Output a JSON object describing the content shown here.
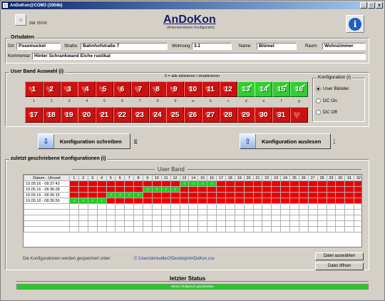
{
  "window": {
    "title": "AnDoKon@COM3 (1004b)",
    "buttons": [
      "_",
      "□",
      "x"
    ]
  },
  "header": {
    "sw_version": "SW: 25703",
    "title": "AnDoKon",
    "subtitle": "(Antennendosen Konfigurator)"
  },
  "ortsdaten": {
    "legend": "Ortsdaten",
    "ort_label": "Ort:",
    "ort_value": "Posemuckel",
    "strasse_label": "Straße:",
    "strasse_value": "Bahnhofstraße 7",
    "wohnung_label": "Wohnung:",
    "wohnung_value": "3.1",
    "name_label": "Name:",
    "name_value": "Blümel",
    "raum_label": "Raum:",
    "raum_value": "Wohnzimmer",
    "kommentar_label": "Kommentar:",
    "kommentar_value": "Hinter Schrankwand Eiche rustikal"
  },
  "user_band": {
    "legend": "User Band Auswahl (i)",
    "hint": "0 = alle aktivieren / deaktivieren",
    "row1": [
      {
        "n": "1",
        "on": false
      },
      {
        "n": "2",
        "on": false
      },
      {
        "n": "3",
        "on": false
      },
      {
        "n": "4",
        "on": false
      },
      {
        "n": "5",
        "on": false
      },
      {
        "n": "6",
        "on": false
      },
      {
        "n": "7",
        "on": false
      },
      {
        "n": "8",
        "on": false
      },
      {
        "n": "9",
        "on": false
      },
      {
        "n": "10",
        "on": false
      },
      {
        "n": "11",
        "on": false
      },
      {
        "n": "12",
        "on": false
      },
      {
        "n": "13",
        "on": true
      },
      {
        "n": "14",
        "on": true
      },
      {
        "n": "15",
        "on": true
      },
      {
        "n": "16",
        "on": true
      }
    ],
    "row1_keys": [
      "1",
      "2",
      "3",
      "4",
      "5",
      "6",
      "7",
      "8",
      "9",
      "a",
      "b",
      "c",
      "d",
      "e",
      "f",
      "g"
    ],
    "row2": [
      {
        "n": "17"
      },
      {
        "n": "18"
      },
      {
        "n": "19"
      },
      {
        "n": "20"
      },
      {
        "n": "21"
      },
      {
        "n": "22"
      },
      {
        "n": "23"
      },
      {
        "n": "24"
      },
      {
        "n": "25"
      },
      {
        "n": "26"
      },
      {
        "n": "27"
      },
      {
        "n": "28"
      },
      {
        "n": "29"
      },
      {
        "n": "30"
      },
      {
        "n": "31"
      },
      {
        "n": ""
      }
    ]
  },
  "konfiguration": {
    "legend": "Konfiguration (i)",
    "options": [
      {
        "label": "User Bänder",
        "selected": true
      },
      {
        "label": "DC On",
        "selected": false
      },
      {
        "label": "DC Off",
        "selected": false
      }
    ]
  },
  "actions": {
    "write_label": "Konfiguration schreiben",
    "write_key": "w",
    "read_label": "Konfiguration auslesen",
    "read_key": "!"
  },
  "history": {
    "legend": "zuletzt geschriebene Konfigurationen (i)",
    "band_header": "User Band",
    "col_timestamp": "Datum - Uhrzeit",
    "columns": [
      "1",
      "2",
      "3",
      "4",
      "5",
      "6",
      "7",
      "8",
      "9",
      "10",
      "11",
      "12",
      "13",
      "14",
      "15",
      "16",
      "17",
      "18",
      "19",
      "20",
      "21",
      "22",
      "23",
      "24",
      "25",
      "26",
      "27",
      "28",
      "29",
      "30",
      "31",
      "32"
    ],
    "rows": [
      {
        "ts": "19.05.16 - 08:37:43",
        "on": [
          13,
          14,
          15,
          16
        ]
      },
      {
        "ts": "19.05.16 - 08:36:28",
        "on": [
          9,
          10,
          11,
          12
        ]
      },
      {
        "ts": "19.05.16 - 08:36:15",
        "on": [
          5,
          6,
          7,
          8
        ]
      },
      {
        "ts": "19.05.16 - 08:35:59",
        "on": [
          1,
          2,
          3,
          4
        ]
      }
    ],
    "check_glyph": "√",
    "empty_rows": 5,
    "path_label": "Die Konfigurationen werden gespeichert unter:",
    "path_value": "C:\\Users\\kmueller2\\Desktop\\AnDoKon.csv",
    "choose_file": "Datei auswählen",
    "open_file": "Datei öffnen"
  },
  "status": {
    "title": "letzter Status",
    "message": "Werte erfolgreich geschrieben"
  }
}
